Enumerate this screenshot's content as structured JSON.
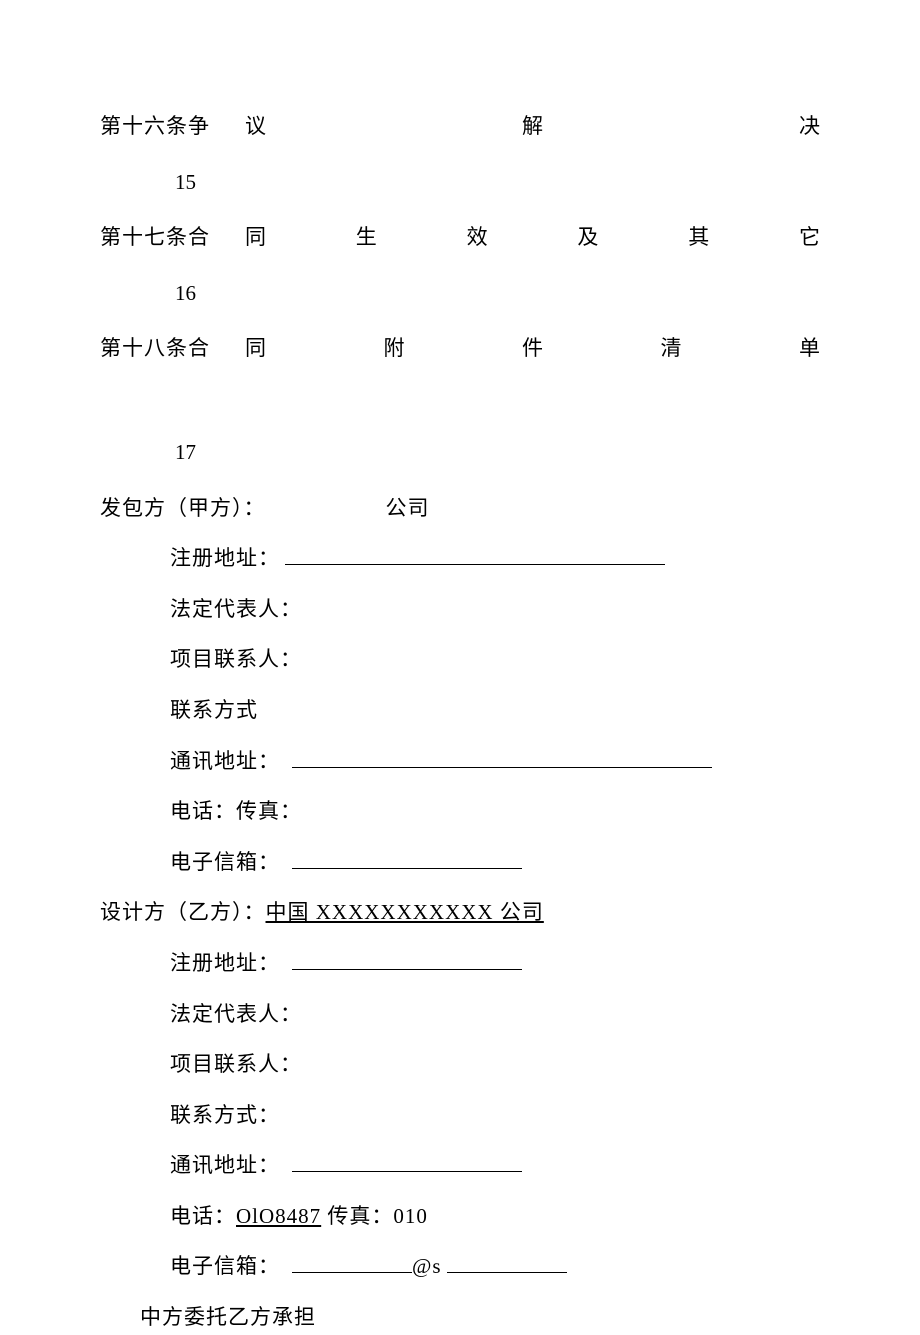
{
  "toc": {
    "item16": {
      "prefix": "第十六条争",
      "chars": [
        "议",
        "解",
        "决"
      ],
      "page": "15"
    },
    "item17": {
      "prefix": "第十七条合",
      "chars": [
        "同",
        "生",
        "效",
        "及",
        "其",
        "它"
      ],
      "page": "16"
    },
    "item18": {
      "prefix": "第十八条合",
      "chars": [
        "同",
        "附",
        "件",
        "清",
        "单"
      ],
      "page": "17"
    }
  },
  "partyA": {
    "title": "发包方（甲方）：",
    "company": "公司",
    "regAddressLabel": "注册地址：",
    "legalRepLabel": "法定代表人：",
    "projectContactLabel": "项目联系人：",
    "contactMethodLabel": "联系方式",
    "mailAddressLabel": "通讯地址：",
    "phoneFaxLabel": "电话：传真：",
    "emailLabel": "电子信箱："
  },
  "partyB": {
    "title": "设计方（乙方）：",
    "companyUnderlined": "中国 XXXXXXXXXXX 公司",
    "regAddressLabel": "注册地址：",
    "legalRepLabel": "法定代表人：",
    "projectContactLabel": "项目联系人：",
    "contactMethodLabel": "联系方式：",
    "mailAddressLabel": "通讯地址：",
    "phonePrefix": "电话：",
    "phoneValue": "OlO8487",
    "faxPrefix": " 传真：",
    "faxValue": "010",
    "emailLabel": "电子信箱：",
    "emailAt": "@s"
  },
  "entrust": "中方委托乙方承担"
}
